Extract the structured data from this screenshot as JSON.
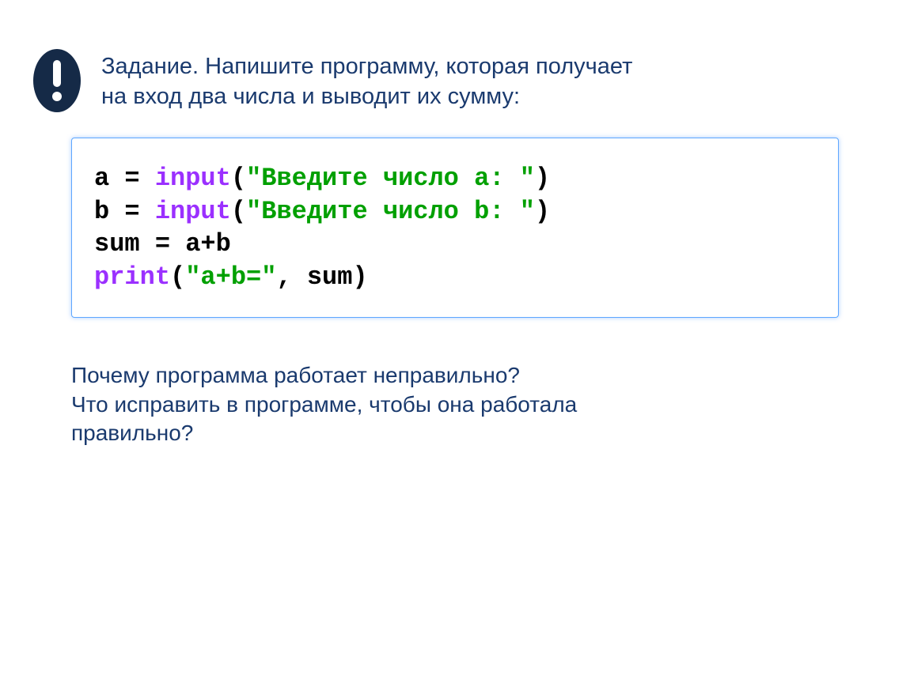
{
  "header": {
    "task_line1": "Задание. Напишите программу, которая получает",
    "task_line2": "на вход два числа и выводит их сумму:"
  },
  "code": {
    "l1_a": "a = ",
    "l1_fn": "input",
    "l1_p": "(",
    "l1_s": "\"Введите число a: \"",
    "l1_c": ")",
    "l2_a": "b = ",
    "l2_fn": "input",
    "l2_p": "(",
    "l2_s": "\"Введите число b: \"",
    "l2_c": ")",
    "l3": "sum = a+b",
    "l4_fn": "print",
    "l4_p": "(",
    "l4_s": "\"a+b=\"",
    "l4_c": ", sum)"
  },
  "questions": {
    "q1": "Почему программа работает неправильно?",
    "q2": "Что исправить в программе, чтобы она работала",
    "q3": "правильно?"
  }
}
